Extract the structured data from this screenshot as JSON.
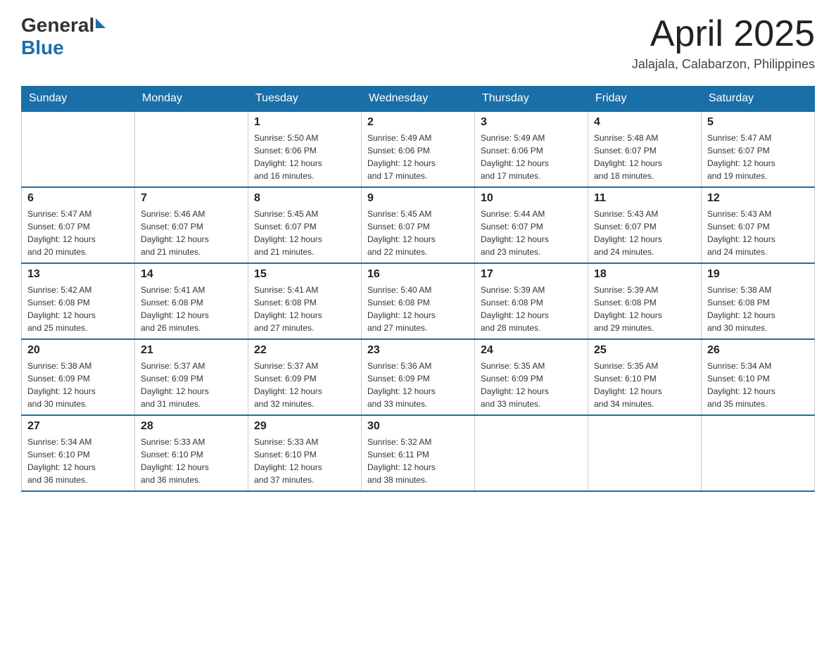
{
  "header": {
    "logo_general": "General",
    "logo_blue": "Blue",
    "month_title": "April 2025",
    "location": "Jalajala, Calabarzon, Philippines"
  },
  "weekdays": [
    "Sunday",
    "Monday",
    "Tuesday",
    "Wednesday",
    "Thursday",
    "Friday",
    "Saturday"
  ],
  "weeks": [
    [
      {
        "day": "",
        "info": ""
      },
      {
        "day": "",
        "info": ""
      },
      {
        "day": "1",
        "info": "Sunrise: 5:50 AM\nSunset: 6:06 PM\nDaylight: 12 hours\nand 16 minutes."
      },
      {
        "day": "2",
        "info": "Sunrise: 5:49 AM\nSunset: 6:06 PM\nDaylight: 12 hours\nand 17 minutes."
      },
      {
        "day": "3",
        "info": "Sunrise: 5:49 AM\nSunset: 6:06 PM\nDaylight: 12 hours\nand 17 minutes."
      },
      {
        "day": "4",
        "info": "Sunrise: 5:48 AM\nSunset: 6:07 PM\nDaylight: 12 hours\nand 18 minutes."
      },
      {
        "day": "5",
        "info": "Sunrise: 5:47 AM\nSunset: 6:07 PM\nDaylight: 12 hours\nand 19 minutes."
      }
    ],
    [
      {
        "day": "6",
        "info": "Sunrise: 5:47 AM\nSunset: 6:07 PM\nDaylight: 12 hours\nand 20 minutes."
      },
      {
        "day": "7",
        "info": "Sunrise: 5:46 AM\nSunset: 6:07 PM\nDaylight: 12 hours\nand 21 minutes."
      },
      {
        "day": "8",
        "info": "Sunrise: 5:45 AM\nSunset: 6:07 PM\nDaylight: 12 hours\nand 21 minutes."
      },
      {
        "day": "9",
        "info": "Sunrise: 5:45 AM\nSunset: 6:07 PM\nDaylight: 12 hours\nand 22 minutes."
      },
      {
        "day": "10",
        "info": "Sunrise: 5:44 AM\nSunset: 6:07 PM\nDaylight: 12 hours\nand 23 minutes."
      },
      {
        "day": "11",
        "info": "Sunrise: 5:43 AM\nSunset: 6:07 PM\nDaylight: 12 hours\nand 24 minutes."
      },
      {
        "day": "12",
        "info": "Sunrise: 5:43 AM\nSunset: 6:07 PM\nDaylight: 12 hours\nand 24 minutes."
      }
    ],
    [
      {
        "day": "13",
        "info": "Sunrise: 5:42 AM\nSunset: 6:08 PM\nDaylight: 12 hours\nand 25 minutes."
      },
      {
        "day": "14",
        "info": "Sunrise: 5:41 AM\nSunset: 6:08 PM\nDaylight: 12 hours\nand 26 minutes."
      },
      {
        "day": "15",
        "info": "Sunrise: 5:41 AM\nSunset: 6:08 PM\nDaylight: 12 hours\nand 27 minutes."
      },
      {
        "day": "16",
        "info": "Sunrise: 5:40 AM\nSunset: 6:08 PM\nDaylight: 12 hours\nand 27 minutes."
      },
      {
        "day": "17",
        "info": "Sunrise: 5:39 AM\nSunset: 6:08 PM\nDaylight: 12 hours\nand 28 minutes."
      },
      {
        "day": "18",
        "info": "Sunrise: 5:39 AM\nSunset: 6:08 PM\nDaylight: 12 hours\nand 29 minutes."
      },
      {
        "day": "19",
        "info": "Sunrise: 5:38 AM\nSunset: 6:08 PM\nDaylight: 12 hours\nand 30 minutes."
      }
    ],
    [
      {
        "day": "20",
        "info": "Sunrise: 5:38 AM\nSunset: 6:09 PM\nDaylight: 12 hours\nand 30 minutes."
      },
      {
        "day": "21",
        "info": "Sunrise: 5:37 AM\nSunset: 6:09 PM\nDaylight: 12 hours\nand 31 minutes."
      },
      {
        "day": "22",
        "info": "Sunrise: 5:37 AM\nSunset: 6:09 PM\nDaylight: 12 hours\nand 32 minutes."
      },
      {
        "day": "23",
        "info": "Sunrise: 5:36 AM\nSunset: 6:09 PM\nDaylight: 12 hours\nand 33 minutes."
      },
      {
        "day": "24",
        "info": "Sunrise: 5:35 AM\nSunset: 6:09 PM\nDaylight: 12 hours\nand 33 minutes."
      },
      {
        "day": "25",
        "info": "Sunrise: 5:35 AM\nSunset: 6:10 PM\nDaylight: 12 hours\nand 34 minutes."
      },
      {
        "day": "26",
        "info": "Sunrise: 5:34 AM\nSunset: 6:10 PM\nDaylight: 12 hours\nand 35 minutes."
      }
    ],
    [
      {
        "day": "27",
        "info": "Sunrise: 5:34 AM\nSunset: 6:10 PM\nDaylight: 12 hours\nand 36 minutes."
      },
      {
        "day": "28",
        "info": "Sunrise: 5:33 AM\nSunset: 6:10 PM\nDaylight: 12 hours\nand 36 minutes."
      },
      {
        "day": "29",
        "info": "Sunrise: 5:33 AM\nSunset: 6:10 PM\nDaylight: 12 hours\nand 37 minutes."
      },
      {
        "day": "30",
        "info": "Sunrise: 5:32 AM\nSunset: 6:11 PM\nDaylight: 12 hours\nand 38 minutes."
      },
      {
        "day": "",
        "info": ""
      },
      {
        "day": "",
        "info": ""
      },
      {
        "day": "",
        "info": ""
      }
    ]
  ]
}
